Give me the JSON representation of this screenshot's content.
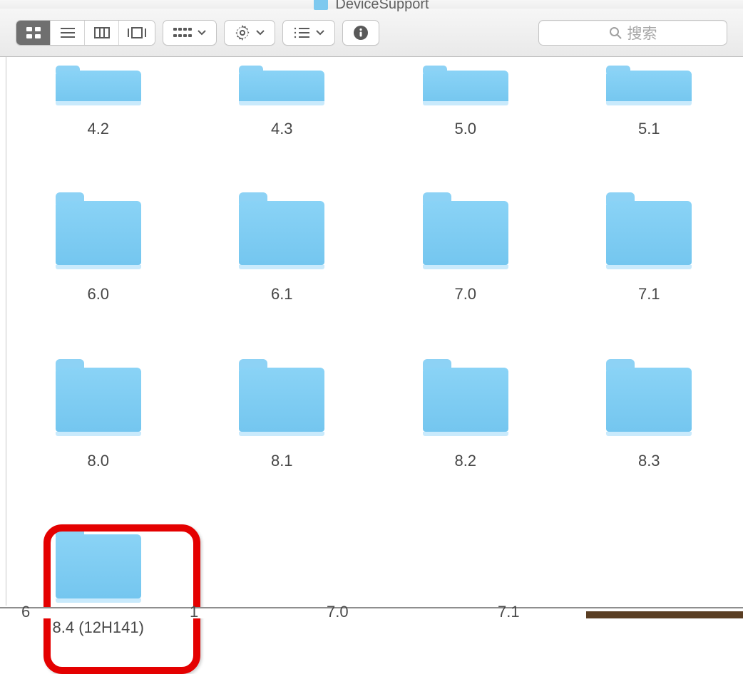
{
  "window": {
    "title": "DeviceSupport"
  },
  "search": {
    "placeholder": "搜索"
  },
  "folders": [
    [
      {
        "name": "4.2"
      },
      {
        "name": "4.3"
      },
      {
        "name": "5.0"
      },
      {
        "name": "5.1"
      }
    ],
    [
      {
        "name": "6.0"
      },
      {
        "name": "6.1"
      },
      {
        "name": "7.0"
      },
      {
        "name": "7.1"
      }
    ],
    [
      {
        "name": "8.0"
      },
      {
        "name": "8.1"
      },
      {
        "name": "8.2"
      },
      {
        "name": "8.3"
      }
    ],
    [
      {
        "name": "8.4 (12H141)"
      }
    ]
  ],
  "bottom_partial": {
    "a": "6",
    "b": "1",
    "c": "7.0",
    "d": "7.1"
  }
}
